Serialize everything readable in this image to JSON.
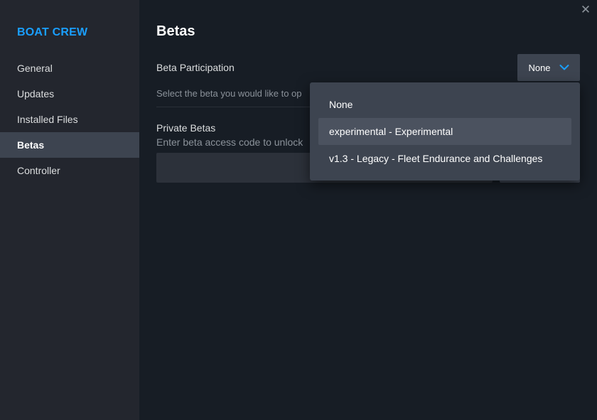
{
  "app": {
    "close_glyph": "✕"
  },
  "sidebar": {
    "game_title": "BOAT CREW",
    "items": [
      {
        "label": "General",
        "active": false
      },
      {
        "label": "Updates",
        "active": false
      },
      {
        "label": "Installed Files",
        "active": false
      },
      {
        "label": "Betas",
        "active": true
      },
      {
        "label": "Controller",
        "active": false
      }
    ]
  },
  "main": {
    "title": "Betas",
    "beta_participation": {
      "label": "Beta Participation",
      "selected": "None",
      "description": "Select the beta you would like to op"
    },
    "private_betas": {
      "label": "Private Betas",
      "description": "Enter beta access code to unlock",
      "input_value": "",
      "input_placeholder": "",
      "button_label": ""
    }
  },
  "dropdown": {
    "options": [
      {
        "label": "None",
        "highlighted": false
      },
      {
        "label": "experimental - Experimental",
        "highlighted": true
      },
      {
        "label": "v1.3 - Legacy - Fleet Endurance and Challenges",
        "highlighted": false
      }
    ]
  },
  "colors": {
    "accent": "#1a9fff",
    "background": "#171d25",
    "sidebar": "#23262e",
    "active_item": "#3d4450",
    "dropdown_bg": "#3d4450",
    "dropdown_hover": "#4b525f"
  },
  "icons": {
    "close": "close-icon",
    "select_chevron": "chevron-down-icon"
  }
}
